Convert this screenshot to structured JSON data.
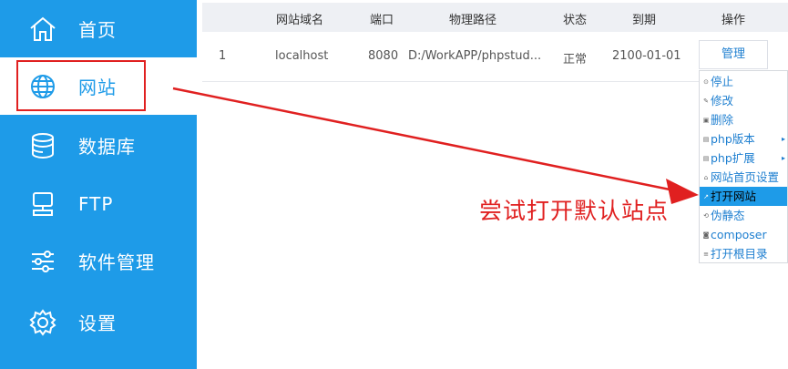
{
  "sidebar": {
    "items": [
      {
        "label": "首页",
        "icon": "home-icon"
      },
      {
        "label": "网站",
        "icon": "globe-icon"
      },
      {
        "label": "数据库",
        "icon": "database-icon"
      },
      {
        "label": "FTP",
        "icon": "monitor-icon"
      },
      {
        "label": "软件管理",
        "icon": "sliders-icon"
      },
      {
        "label": "设置",
        "icon": "gear-icon"
      }
    ],
    "active_index": 1
  },
  "table": {
    "headers": [
      "网站域名",
      "端口",
      "物理路径",
      "状态",
      "到期",
      "操作"
    ],
    "rows": [
      {
        "index": "1",
        "domain": "localhost",
        "port": "8080",
        "path": "D:/WorkAPP/phpstud...",
        "status": "正常",
        "expire": "2100-01-01",
        "action": "管理"
      }
    ]
  },
  "context_menu": {
    "items": [
      {
        "label": "停止",
        "icon": "stop-icon"
      },
      {
        "label": "修改",
        "icon": "edit-icon"
      },
      {
        "label": "删除",
        "icon": "trash-icon"
      },
      {
        "label": "php版本",
        "icon": "php-icon",
        "submenu": true
      },
      {
        "label": "php扩展",
        "icon": "extension-icon",
        "submenu": true
      },
      {
        "label": "网站首页设置",
        "icon": "home-icon"
      },
      {
        "label": "打开网站",
        "icon": "open-icon",
        "selected": true
      },
      {
        "label": "伪静态",
        "icon": "rewrite-icon"
      },
      {
        "label": "composer",
        "icon": "package-icon"
      },
      {
        "label": "打开根目录",
        "icon": "folder-icon"
      }
    ]
  },
  "annotation": {
    "text": "尝试打开默认站点",
    "color": "#e02020"
  },
  "colors": {
    "sidebar": "#1e9be8",
    "accent_red": "#e02020",
    "link": "#1e7fd0"
  }
}
